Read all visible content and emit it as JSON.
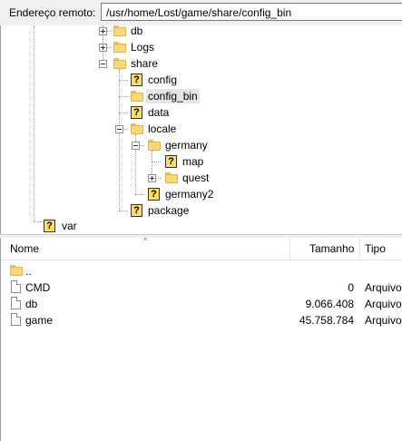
{
  "address": {
    "label": "Endereço remoto:",
    "value": "/usr/home/Lost/game/share/config_bin"
  },
  "tree": {
    "nodes": [
      {
        "label": "db",
        "icon": "folder",
        "expander": "plus"
      },
      {
        "label": "Logs",
        "icon": "folder",
        "expander": "plus"
      },
      {
        "label": "share",
        "icon": "folder",
        "expander": "minus"
      },
      {
        "label": "config",
        "icon": "question"
      },
      {
        "label": "config_bin",
        "icon": "folder",
        "selected": true
      },
      {
        "label": "data",
        "icon": "question"
      },
      {
        "label": "locale",
        "icon": "folder",
        "expander": "minus"
      },
      {
        "label": "germany",
        "icon": "folder",
        "expander": "minus"
      },
      {
        "label": "map",
        "icon": "question"
      },
      {
        "label": "quest",
        "icon": "folder",
        "expander": "plus"
      },
      {
        "label": "germany2",
        "icon": "question"
      },
      {
        "label": "package",
        "icon": "question"
      },
      {
        "label": "var",
        "icon": "question"
      }
    ]
  },
  "list": {
    "columns": {
      "name": "Nome",
      "size": "Tamanho",
      "type": "Tipo"
    },
    "rows": [
      {
        "name": "..",
        "size": "",
        "type": "",
        "icon": "folder"
      },
      {
        "name": "CMD",
        "size": "0",
        "type": "Arquivo",
        "icon": "file"
      },
      {
        "name": "db",
        "size": "9.066.408",
        "type": "Arquivo",
        "icon": "file"
      },
      {
        "name": "game",
        "size": "45.758.784",
        "type": "Arquivo",
        "icon": "file"
      }
    ]
  },
  "colors": {
    "folder": "#fcd873",
    "question_icon": "#ffdd55",
    "selected": "#e5e5e5"
  }
}
